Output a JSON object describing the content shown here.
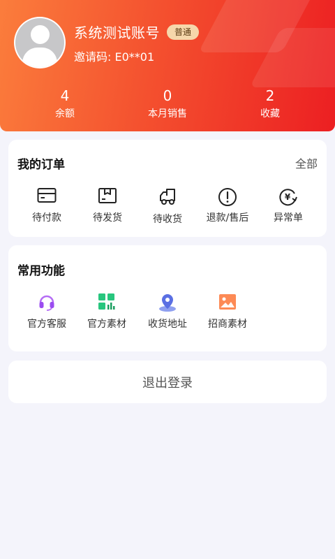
{
  "profile": {
    "username": "系统测试账号",
    "level_badge": "普通",
    "invite_text": "邀请码: E0**01",
    "avatar_icon": "default-user-avatar"
  },
  "stats": [
    {
      "value": "4",
      "label": "余额"
    },
    {
      "value": "0",
      "label": "本月销售"
    },
    {
      "value": "2",
      "label": "收藏"
    }
  ],
  "orders": {
    "title": "我的订单",
    "all_label": "全部",
    "items": [
      {
        "label": "待付款",
        "icon": "card-icon"
      },
      {
        "label": "待发货",
        "icon": "box-icon"
      },
      {
        "label": "待收货",
        "icon": "truck-icon"
      },
      {
        "label": "退款/售后",
        "icon": "alert-icon"
      },
      {
        "label": "异常单",
        "icon": "yen-exchange-icon"
      }
    ]
  },
  "functions": {
    "title": "常用功能",
    "items": [
      {
        "label": "官方客服",
        "icon": "headset-icon",
        "color": "#a855f7"
      },
      {
        "label": "官方素材",
        "icon": "grid-chart-icon",
        "color": "#22c37a"
      },
      {
        "label": "收货地址",
        "icon": "location-pin-icon",
        "color": "#6478e8"
      },
      {
        "label": "招商素材",
        "icon": "image-icon",
        "color": "#fb7b45"
      }
    ]
  },
  "logout_label": "退出登录",
  "colors": {
    "header_start": "#fb7d3c",
    "header_end": "#ec1f22",
    "badge_bg": "#f6d7ab",
    "page_bg": "#f4f4fb"
  }
}
